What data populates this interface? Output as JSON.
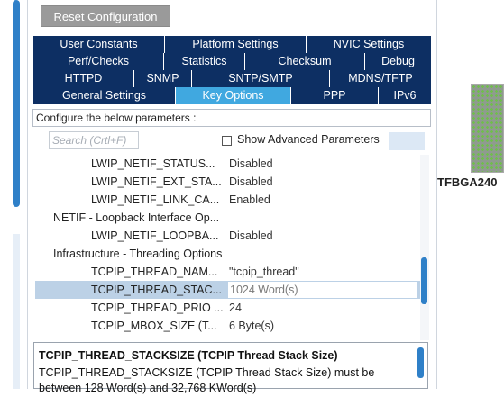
{
  "reset_label": "Reset Configuration",
  "tabs": {
    "row1": [
      "User Constants",
      "Platform Settings",
      "NVIC Settings"
    ],
    "row2": [
      "Perf/Checks",
      "Statistics",
      "Checksum",
      "Debug"
    ],
    "row3": [
      "HTTPD",
      "SNMP",
      "SNTP/SMTP",
      "MDNS/TFTP"
    ],
    "row4": [
      "General Settings",
      "Key Options",
      "PPP",
      "IPv6"
    ],
    "active": "Key Options"
  },
  "config_prompt": "Configure the below parameters :",
  "search": {
    "placeholder": "Search (Crtl+F)"
  },
  "show_advanced": {
    "label": "Show Advanced Parameters",
    "checked": false
  },
  "params": [
    {
      "name": "LWIP_NETIF_STATUS...",
      "value": "Disabled"
    },
    {
      "name": "LWIP_NETIF_EXT_STA...",
      "value": "Disabled"
    },
    {
      "name": "LWIP_NETIF_LINK_CA...",
      "value": "Enabled"
    },
    {
      "name": "NETIF - Loopback Interface Op...",
      "value": ""
    },
    {
      "name": "LWIP_NETIF_LOOPBA...",
      "value": "Disabled"
    },
    {
      "name": "Infrastructure - Threading Options",
      "value": ""
    },
    {
      "name": "TCPIP_THREAD_NAM...",
      "value": "\"tcpip_thread\""
    },
    {
      "name": "TCPIP_THREAD_STAC...",
      "value": "1024 Word(s)"
    },
    {
      "name": "TCPIP_THREAD_PRIO ...",
      "value": "24"
    },
    {
      "name": "TCPIP_MBOX_SIZE (T...",
      "value": "6 Byte(s)"
    }
  ],
  "description": {
    "title": "TCPIP_THREAD_STACKSIZE (TCPIP Thread Stack Size)",
    "text": "TCPIP_THREAD_STACKSIZE (TCPIP Thread Stack Size) must be between 128 Word(s) and 32,768 KWord(s)"
  },
  "chip_label": "TFBGA240"
}
